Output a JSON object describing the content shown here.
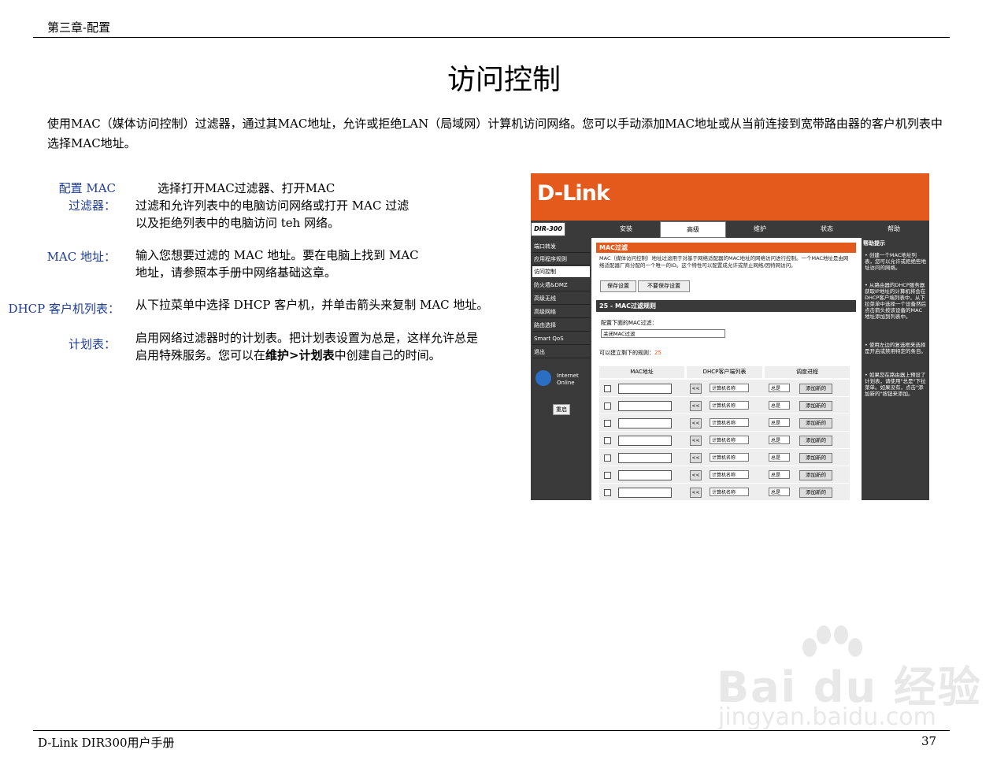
{
  "header": {
    "chapter": "第三章-配置"
  },
  "page": {
    "title": "访问控制",
    "intro": "使用MAC（媒体访问控制）过滤器，通过其MAC地址，允许或拒绝LAN（局域网）计算机访问网络。您可以手动添加MAC地址或从当前连接到宽带路由器的客户机列表中选择MAC地址。"
  },
  "definitions": [
    {
      "term_line1": "配置 MAC",
      "term_line2": "过滤器：",
      "lines": [
        "选择打开MAC过滤器、打开MAC",
        "过滤和允许列表中的电脑访问网络或打开 MAC 过滤",
        "以及拒绝列表中的电脑访问 teh 网络。"
      ]
    },
    {
      "term": "MAC 地址：",
      "lines": [
        "输入您想要过滤的 MAC 地址。要在电脑上找到 MAC",
        "地址，请参照本手册中网络基础这章。"
      ]
    },
    {
      "term": "DHCP 客户机列表：",
      "lines": [
        "从下拉菜单中选择 DHCP 客户机，并单击箭头来复制 MAC 地址。"
      ]
    },
    {
      "term": "计划表：",
      "lines": [
        "启用网络过滤器时的计划表。把计划表设置为总是，这样允许总是"
      ],
      "line2_prefix": "启用特殊服务。您可以在",
      "line2_bold": "维护>计划表",
      "line2_suffix": "中创建自己的时间。"
    }
  ],
  "footer": {
    "left": "D-Link DIR300用户手册",
    "page_number": "37"
  },
  "screenshot": {
    "logo": "D-Link",
    "model": "DIR-300",
    "tabs": [
      "安装",
      "高级",
      "维护",
      "状态",
      "帮助"
    ],
    "active_tab": "高级",
    "left_nav": [
      "端口转发",
      "应用程序规则",
      "访问控制",
      "防火墙&DMZ",
      "高级无线",
      "高级网络",
      "路由选择",
      "Smart QoS",
      "退出"
    ],
    "active_nav": "访问控制",
    "ie_text_1": "Internet",
    "ie_text_2": "Online",
    "reboot": "重启",
    "section_title": "MAC过滤",
    "section_desc": "MAC（媒体访问控制）地址过滤用于对基于网络适配器的MAC地址的网络访问进行控制。一个MAC地址是由网络适配器厂商分配的一个唯一的ID。这个特性可以配置成允许或禁止网络/因特网访问。",
    "save_btn": "保存设置",
    "nosave_btn": "不要保存设置",
    "rules_title": "25 - MAC过滤规则",
    "config_label": "配置下面的MAC过滤：",
    "filter_value": "关闭MAC过滤",
    "remaining_label": "可以建立剩下的规则：",
    "remaining_count": "25",
    "col_mac": "MAC地址",
    "col_dhcp": "DHCP客户端列表",
    "col_schedule": "调度进程",
    "rows": [
      {
        "copy": "<<",
        "dhcp": "计算机名称",
        "schedule": "总是",
        "add": "添加新的"
      },
      {
        "copy": "<<",
        "dhcp": "计算机名称",
        "schedule": "总是",
        "add": "添加新的"
      },
      {
        "copy": "<<",
        "dhcp": "计算机名称",
        "schedule": "总是",
        "add": "添加新的"
      },
      {
        "copy": "<<",
        "dhcp": "计算机名称",
        "schedule": "总是",
        "add": "添加新的"
      },
      {
        "copy": "<<",
        "dhcp": "计算机名称",
        "schedule": "总是",
        "add": "添加新的"
      },
      {
        "copy": "<<",
        "dhcp": "计算机名称",
        "schedule": "总是",
        "add": "添加新的"
      },
      {
        "copy": "<<",
        "dhcp": "计算机名称",
        "schedule": "总是",
        "add": "添加新的"
      }
    ],
    "help_title": "帮助提示",
    "help_1": "• 创建一个MAC地址列表，您可以允许或拒绝些地址访问的网络。",
    "help_2": "• 从路由器的DHCP服务器获取IP地址的计算机将会在DHCP客户端列表中，从下拉菜单中选择一个设备然后点击箭头按该设备的MAC地址添加到列表中。",
    "help_3": "• 使用左边的复选框来选择是开启或禁用特定的条目。",
    "help_4": "• 如果您在路由器上预设了计划表，请使用\"总是\"下拉菜单。如果没有，点击\"添加新的\"按钮来添加。"
  },
  "watermark": {
    "brand": "Bai du 经验",
    "url": "jingyan.baidu.com"
  }
}
